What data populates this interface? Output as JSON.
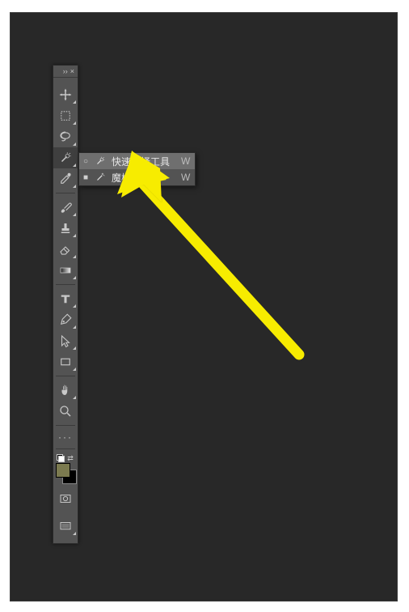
{
  "panel": {
    "collapse_glyph": "››",
    "close_glyph": "×"
  },
  "tools": [
    {
      "name": "move-tool",
      "flyout": true
    },
    {
      "name": "marquee-tool",
      "flyout": true
    },
    {
      "name": "lasso-tool",
      "flyout": true
    },
    {
      "name": "quick-select-tool",
      "flyout": true,
      "selected": true
    },
    {
      "name": "eyedropper-tool",
      "flyout": true
    },
    {
      "name": "brush-tool",
      "flyout": true
    },
    {
      "name": "stamp-tool",
      "flyout": true
    },
    {
      "name": "eraser-tool",
      "flyout": true
    },
    {
      "name": "gradient-tool",
      "flyout": true
    },
    {
      "name": "type-tool",
      "flyout": true
    },
    {
      "name": "pen-tool",
      "flyout": true
    },
    {
      "name": "path-select-tool",
      "flyout": true
    },
    {
      "name": "shape-tool",
      "flyout": true
    },
    {
      "name": "hand-tool",
      "flyout": true
    },
    {
      "name": "zoom-tool",
      "flyout": false
    }
  ],
  "more_tools_glyph": "···",
  "swatch": {
    "arrow_glyph": "⇄",
    "fg_color": "#7b7a4f",
    "bg_color": "#000000"
  },
  "mask_modes": [
    {
      "name": "quick-mask-mode"
    }
  ],
  "screen_modes": [
    {
      "name": "screen-mode"
    }
  ],
  "flyout": {
    "items": [
      {
        "bullet": "○",
        "label": "快速选择工具",
        "shortcut": "W",
        "active": true,
        "icon": "quick-select"
      },
      {
        "bullet": "■",
        "label": "魔棒工具",
        "shortcut": "W",
        "active": false,
        "icon": "magic-wand"
      }
    ]
  }
}
